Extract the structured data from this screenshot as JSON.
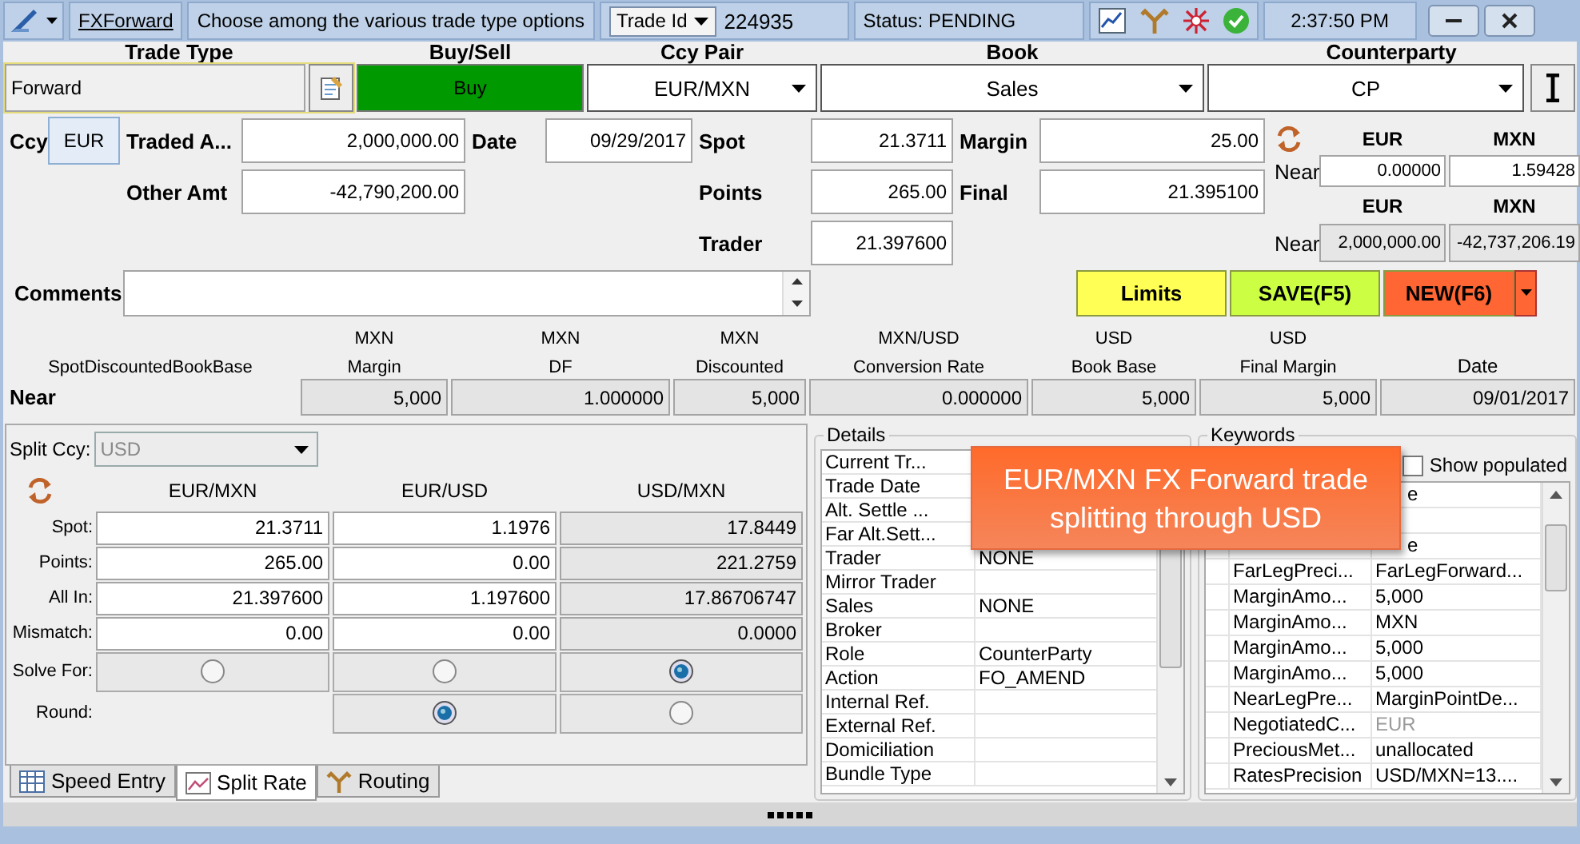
{
  "toolbar": {
    "module_link": "FXForward",
    "hint": "Choose among the various trade type options",
    "id_selector": {
      "label": "Trade Id",
      "value": "224935"
    },
    "status": "Status: PENDING",
    "time": "2:37:50 PM"
  },
  "header": [
    {
      "kind": "text",
      "label": "Trade Type",
      "value": "Forward",
      "focused": true
    },
    {
      "kind": "toggle",
      "label": "Buy/Sell",
      "value": "Buy",
      "color": "#009900",
      "focused": false
    },
    {
      "kind": "dropdown",
      "label": "Ccy Pair",
      "value": "EUR/MXN",
      "focused": false
    },
    {
      "kind": "dropdown",
      "label": "Book",
      "value": "Sales",
      "focused": false
    },
    {
      "kind": "dropdown",
      "label": "Counterparty",
      "value": "CP",
      "focused": false
    }
  ],
  "trade": {
    "ccy_label": "Ccy",
    "ccy": "EUR",
    "traded_amount": {
      "label": "Traded A...",
      "value": "2,000,000.00"
    },
    "other_amount": {
      "label": "Other Amt",
      "value": "-42,790,200.00"
    },
    "date": {
      "label": "Date",
      "value": "09/29/2017"
    },
    "spot": {
      "label": "Spot",
      "value": "21.3711"
    },
    "points": {
      "label": "Points",
      "value": "265.00"
    },
    "trader": {
      "label": "Trader",
      "value": "21.397600"
    },
    "margin": {
      "label": "Margin",
      "value": "25.00"
    },
    "final": {
      "label": "Final",
      "value": "21.395100"
    }
  },
  "near_amounts": [
    {
      "currencies": [
        "EUR",
        "MXN"
      ],
      "label": "Near",
      "values": [
        "0.00000",
        "1.59428"
      ],
      "readonly": false
    },
    {
      "currencies": [
        "EUR",
        "MXN"
      ],
      "label": "Near",
      "values": [
        "2,000,000.00",
        "-42,737,206.19"
      ],
      "readonly": true
    }
  ],
  "comments": {
    "label": "Comments"
  },
  "actions": [
    {
      "label": "Limits",
      "color": "#ffff55",
      "menu": false
    },
    {
      "label": "SAVE(F5)",
      "color": "#ccff44",
      "menu": false
    },
    {
      "label": "NEW(F6)",
      "color": "#ff6633",
      "menu": true
    }
  ],
  "breakdown": {
    "row_label_header": "SpotDiscountedBookBase",
    "columns": [
      {
        "unit": "MXN",
        "label": "Margin"
      },
      {
        "unit": "MXN",
        "label": "DF"
      },
      {
        "unit": "MXN",
        "label": "Discounted"
      },
      {
        "unit": "MXN/USD",
        "label": "Conversion Rate"
      },
      {
        "unit": "USD",
        "label": "Book Base"
      },
      {
        "unit": "USD",
        "label": "Final Margin"
      },
      {
        "label": "Date"
      }
    ],
    "rows": [
      {
        "label": "Near",
        "cells": [
          "5,000",
          "1.000000",
          "5,000",
          "0.000000",
          "5,000",
          "5,000",
          "09/01/2017"
        ]
      }
    ]
  },
  "split": {
    "ccy_label": "Split Ccy:",
    "ccy": "USD",
    "ccy_disabled": true,
    "row_labels": [
      "Spot:",
      "Points:",
      "All In:",
      "Mismatch:"
    ],
    "solve_label": "Solve For:",
    "round_label": "Round:",
    "columns": [
      {
        "pair": "EUR/MXN",
        "values": [
          "21.3711",
          "265.00",
          "21.397600",
          "0.00"
        ],
        "readonly": false,
        "solve_for": false
      },
      {
        "pair": "EUR/USD",
        "values": [
          "1.1976",
          "0.00",
          "1.197600",
          "0.00"
        ],
        "readonly": false,
        "solve_for": false,
        "round": true
      },
      {
        "pair": "USD/MXN",
        "values": [
          "17.8449",
          "221.2759",
          "17.86706747",
          "0.0000"
        ],
        "readonly": true,
        "solve_for": true,
        "round": false
      }
    ]
  },
  "tabs": [
    {
      "label": "Speed Entry",
      "selected": false
    },
    {
      "label": "Split Rate",
      "selected": true
    },
    {
      "label": "Routing",
      "selected": false
    }
  ],
  "details": {
    "title": "Details",
    "rows": [
      {
        "name": "Current Tr..."
      },
      {
        "name": "Trade Date"
      },
      {
        "name": "Alt. Settle ..."
      },
      {
        "name": "Far Alt.Sett..."
      },
      {
        "name": "Trader",
        "value": "NONE"
      },
      {
        "name": "Mirror Trader"
      },
      {
        "name": "Sales",
        "value": "NONE"
      },
      {
        "name": "Broker"
      },
      {
        "name": "Role",
        "value": "CounterParty"
      },
      {
        "name": "Action",
        "value": "FO_AMEND"
      },
      {
        "name": "Internal Ref."
      },
      {
        "name": "External Ref."
      },
      {
        "name": "Domiciliation"
      },
      {
        "name": "Bundle Type"
      }
    ]
  },
  "keywords": {
    "title": "Keywords",
    "show_populated": {
      "label": "Show populated",
      "checked": false
    },
    "rows": [
      {
        "covered": true,
        "value": "e",
        "disabled": false
      },
      {
        "covered": true,
        "disabled": false
      },
      {
        "covered": true,
        "value": "e",
        "disabled": false
      },
      {
        "covered": false,
        "name": "FarLegPreci...",
        "value": "FarLegForward...",
        "disabled": false
      },
      {
        "covered": false,
        "name": "MarginAmo...",
        "value": "5,000",
        "disabled": false
      },
      {
        "covered": false,
        "name": "MarginAmo...",
        "value": "MXN",
        "disabled": false
      },
      {
        "covered": false,
        "name": "MarginAmo...",
        "value": "5,000",
        "disabled": false
      },
      {
        "covered": false,
        "name": "MarginAmo...",
        "value": "5,000",
        "disabled": false
      },
      {
        "covered": false,
        "name": "NearLegPre...",
        "value": "MarginPointDe...",
        "disabled": false
      },
      {
        "covered": false,
        "name": "NegotiatedC...",
        "value": "EUR",
        "disabled": true
      },
      {
        "covered": false,
        "name": "PreciousMet...",
        "value": "unallocated",
        "disabled": false
      },
      {
        "covered": false,
        "name": "RatesPrecision",
        "value": "USD/MXN=13....",
        "disabled": false
      }
    ]
  },
  "callout": "EUR/MXN FX Forward trade splitting through USD"
}
